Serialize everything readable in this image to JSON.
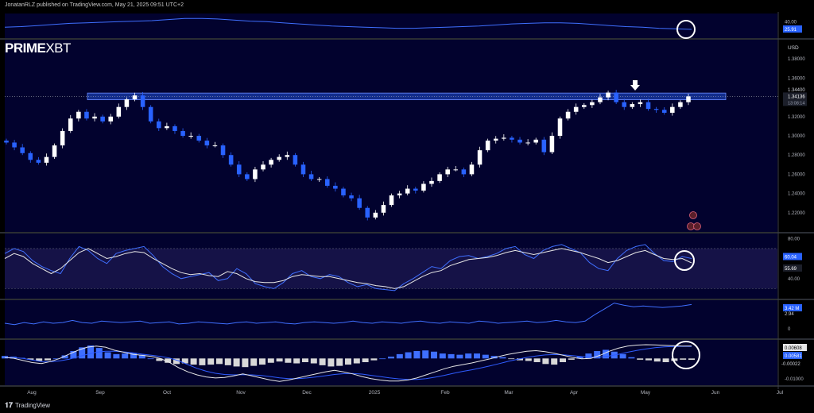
{
  "header": {
    "published": "JonatanRLZ published on TradingView.com, May 21, 2025 09:51 UTC+2"
  },
  "brand": {
    "bold": "PRIME",
    "thin": "XBT"
  },
  "footer": {
    "logo_text": "TradingView",
    "logo_icon": "tradingview-logo-icon"
  },
  "colors": {
    "background": "#000000",
    "pane": "#02022e",
    "accent": "#2962ff",
    "candle_up": "#ffffff",
    "candle_down": "#2962ff",
    "zone": "#2962ff"
  },
  "chart_data": [
    {
      "pane": "top-indicator",
      "type": "line",
      "ylim": [
        10,
        55
      ],
      "ticks": [
        "40.00"
      ],
      "current_label": "25.91",
      "series": [
        {
          "values": [
            30,
            31,
            33,
            35,
            37,
            38,
            39,
            40,
            41,
            42,
            44,
            46,
            46,
            45,
            43,
            41,
            40,
            38,
            36,
            34,
            32,
            31,
            30,
            29,
            28,
            28,
            29,
            30,
            31,
            32,
            34,
            36,
            37,
            38,
            38,
            37,
            35,
            33,
            31,
            30,
            28,
            27,
            25.91
          ]
        }
      ]
    },
    {
      "pane": "price",
      "type": "candlestick",
      "ylabel": "USD",
      "ylim": [
        1.2,
        1.4
      ],
      "ticks": [
        "1.38000",
        "1.36000",
        "1.34000",
        "1.32000",
        "1.30000",
        "1.28000",
        "1.26000",
        "1.24000",
        "1.22000"
      ],
      "price_labels": [
        "1.34400",
        "1.34136",
        "13:08:14"
      ],
      "zone": [
        1.3375,
        1.3445
      ],
      "x_labels": [
        "Aug",
        "Sep",
        "Oct",
        "Nov",
        "Dec",
        "2025",
        "Feb",
        "Mar",
        "Apr",
        "May",
        "Jun",
        "Jul"
      ],
      "closes": [
        1.293,
        1.288,
        1.282,
        1.275,
        1.272,
        1.278,
        1.29,
        1.305,
        1.318,
        1.325,
        1.318,
        1.32,
        1.315,
        1.32,
        1.33,
        1.338,
        1.342,
        1.33,
        1.315,
        1.308,
        1.31,
        1.305,
        1.3,
        1.3,
        1.295,
        1.29,
        1.29,
        1.28,
        1.27,
        1.26,
        1.255,
        1.265,
        1.27,
        1.275,
        1.278,
        1.28,
        1.27,
        1.26,
        1.255,
        1.255,
        1.248,
        1.245,
        1.238,
        1.235,
        1.225,
        1.215,
        1.22,
        1.228,
        1.238,
        1.24,
        1.245,
        1.243,
        1.25,
        1.253,
        1.26,
        1.265,
        1.265,
        1.26,
        1.27,
        1.285,
        1.295,
        1.297,
        1.298,
        1.296,
        1.293,
        1.293,
        1.296,
        1.283,
        1.3,
        1.318,
        1.325,
        1.33,
        1.332,
        1.335,
        1.34,
        1.345,
        1.335,
        1.33,
        1.333,
        1.335,
        1.328,
        1.327,
        1.324,
        1.33,
        1.335,
        1.341
      ]
    },
    {
      "pane": "rsi",
      "type": "line",
      "ylim": [
        20,
        85
      ],
      "ticks": [
        "80.00",
        "40.00"
      ],
      "values_labels": [
        "60.04",
        "55.69"
      ],
      "series": [
        {
          "values": [
            60,
            65,
            62,
            55,
            50,
            45,
            50,
            58,
            66,
            70,
            65,
            60,
            62,
            65,
            67,
            66,
            60,
            55,
            50,
            46,
            44,
            45,
            43,
            42,
            47,
            45,
            40,
            37,
            36,
            36,
            38,
            42,
            44,
            43,
            42,
            42,
            40,
            38,
            36,
            35,
            33,
            32,
            30,
            32,
            37,
            42,
            46,
            48,
            53,
            56,
            59,
            60,
            61,
            63,
            66,
            68,
            66,
            64,
            66,
            68,
            70,
            68,
            66,
            63,
            60,
            56,
            58,
            62,
            66,
            68,
            64,
            60,
            59,
            60,
            55.69
          ]
        },
        {
          "values": [
            65,
            70,
            67,
            58,
            52,
            48,
            45,
            60,
            72,
            68,
            60,
            55,
            65,
            68,
            70,
            72,
            63,
            52,
            45,
            40,
            42,
            44,
            46,
            38,
            40,
            50,
            45,
            35,
            32,
            30,
            36,
            45,
            48,
            42,
            40,
            44,
            42,
            36,
            32,
            34,
            30,
            29,
            28,
            35,
            40,
            46,
            52,
            50,
            58,
            62,
            63,
            60,
            62,
            65,
            70,
            72,
            64,
            60,
            68,
            72,
            74,
            70,
            66,
            56,
            50,
            48,
            60,
            68,
            72,
            74,
            65,
            58,
            57,
            62,
            60.04
          ]
        }
      ]
    },
    {
      "pane": "volume-indicator",
      "type": "line",
      "ylim": [
        -1.3,
        4
      ],
      "ticks": [
        "0"
      ],
      "current_labels": [
        "3.42 M",
        "2.94"
      ],
      "series": [
        {
          "values": [
            0.8,
            0.6,
            0.9,
            0.7,
            1.0,
            0.8,
            0.9,
            1.2,
            0.9,
            0.8,
            1.1,
            1.0,
            0.9,
            1.0,
            1.1,
            0.8,
            0.9,
            1.0,
            0.7,
            0.8,
            1.0,
            0.9,
            0.8,
            0.7,
            0.9,
            1.0,
            0.8,
            0.9,
            1.0,
            0.8,
            0.7,
            0.9,
            1.0,
            0.9,
            0.8,
            0.9,
            1.1,
            0.9,
            0.8,
            1.0,
            0.9,
            0.8,
            1.0,
            1.1,
            0.9,
            0.8,
            1.0,
            0.9,
            0.8,
            1.1,
            1.0,
            0.8,
            0.9,
            1.0,
            1.1,
            0.9,
            1.0,
            1.2,
            1.0,
            0.9,
            1.1,
            2.0,
            2.8,
            3.6,
            3.3,
            3.1,
            3.2,
            3.1,
            3.0,
            3.1,
            3.2,
            3.4
          ]
        }
      ]
    },
    {
      "pane": "macd",
      "type": "line",
      "ylim": [
        -0.013,
        0.009
      ],
      "ticks": [
        "-0.01000"
      ],
      "current_labels": [
        "0.00608",
        "0.00581",
        "-0.00022"
      ],
      "histogram": [
        0.0004,
        0.0003,
        0.0001,
        -0.0002,
        -0.0004,
        -0.0003,
        0.0,
        0.0005,
        0.0012,
        0.0018,
        0.0021,
        0.0017,
        0.001,
        0.0007,
        0.0008,
        0.0009,
        0.0006,
        0.0,
        -0.0004,
        -0.0007,
        -0.0009,
        -0.0008,
        -0.001,
        -0.0011,
        -0.001,
        -0.0009,
        -0.0011,
        -0.0013,
        -0.0014,
        -0.0012,
        -0.001,
        -0.0007,
        -0.0005,
        -0.0007,
        -0.0008,
        -0.0006,
        -0.0008,
        -0.0011,
        -0.0013,
        -0.0012,
        -0.001,
        -0.0008,
        -0.0006,
        -0.0003,
        0.0,
        0.0003,
        0.0007,
        0.001,
        0.0012,
        0.0013,
        0.0011,
        0.0008,
        0.0007,
        0.0006,
        0.0008,
        0.0008,
        0.0006,
        0.0004,
        0.0002,
        -0.0001,
        -0.0003,
        -0.0004,
        -0.0006,
        -0.0009,
        -0.001,
        -0.0006,
        -0.0002,
        0.0003,
        0.0008,
        0.0012,
        0.0014,
        0.0011,
        0.0007,
        0.0002,
        -0.0002,
        -0.0003,
        -0.0005,
        -0.0006,
        -0.0004,
        -0.0002,
        -0.00022
      ],
      "series": [
        {
          "values": [
            0.0005,
            0.0001,
            -0.001,
            -0.002,
            -0.0025,
            -0.0015,
            0.0,
            0.002,
            0.004,
            0.0055,
            0.006,
            0.0055,
            0.004,
            0.003,
            0.002,
            0.0015,
            0.001,
            0.0,
            -0.002,
            -0.0045,
            -0.0065,
            -0.008,
            -0.009,
            -0.0095,
            -0.0092,
            -0.0085,
            -0.0075,
            -0.0085,
            -0.0095,
            -0.0105,
            -0.0112,
            -0.0105,
            -0.0095,
            -0.0085,
            -0.0075,
            -0.0065,
            -0.0058,
            -0.0065,
            -0.0075,
            -0.0088,
            -0.0098,
            -0.0105,
            -0.011,
            -0.011,
            -0.0105,
            -0.0095,
            -0.008,
            -0.0065,
            -0.005,
            -0.0038,
            -0.003,
            -0.0022,
            -0.0012,
            -0.0002,
            0.001,
            0.002,
            0.0028,
            0.0035,
            0.0038,
            0.0033,
            0.0025,
            0.0015,
            0.0005,
            -0.0002,
            0.0,
            0.0015,
            0.0035,
            0.005,
            0.006,
            0.0065,
            0.0067,
            0.0066,
            0.0064,
            0.0062,
            0.006,
            0.00608
          ]
        },
        {
          "values": [
            0.0005,
            0.0004,
            0.0,
            -0.0008,
            -0.0015,
            -0.0016,
            -0.0012,
            -0.0004,
            0.0008,
            0.002,
            0.003,
            0.0035,
            0.0035,
            0.0032,
            0.0027,
            0.0021,
            0.0016,
            0.001,
            0.0002,
            -0.0012,
            -0.003,
            -0.0048,
            -0.0062,
            -0.0072,
            -0.0078,
            -0.008,
            -0.0079,
            -0.008,
            -0.0083,
            -0.0088,
            -0.0094,
            -0.0098,
            -0.0098,
            -0.0095,
            -0.009,
            -0.0084,
            -0.0078,
            -0.0074,
            -0.0073,
            -0.0076,
            -0.0082,
            -0.0088,
            -0.0094,
            -0.0099,
            -0.0102,
            -0.0102,
            -0.0098,
            -0.0091,
            -0.0082,
            -0.0072,
            -0.0063,
            -0.0055,
            -0.0046,
            -0.0036,
            -0.0025,
            -0.0014,
            -0.0004,
            0.0005,
            0.0012,
            0.0017,
            0.0019,
            0.0018,
            0.0014,
            0.0009,
            0.0006,
            0.0007,
            0.0012,
            0.002,
            0.003,
            0.0039,
            0.0046,
            0.0052,
            0.0056,
            0.0058,
            0.0059,
            0.00581
          ]
        }
      ]
    }
  ]
}
